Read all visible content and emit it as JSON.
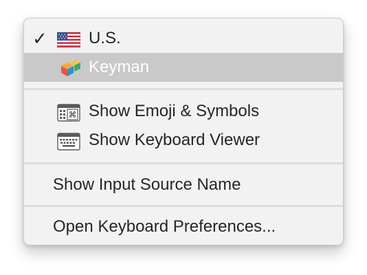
{
  "menu": {
    "items": [
      {
        "label": "U.S.",
        "checked": true,
        "icon": "us-flag-icon"
      },
      {
        "label": "Keyman",
        "selected": true,
        "icon": "keyman-icon"
      },
      {
        "label": "Show Emoji & Symbols",
        "icon": "emoji-symbols-icon"
      },
      {
        "label": "Show Keyboard Viewer",
        "icon": "keyboard-viewer-icon"
      },
      {
        "label": "Show Input Source Name"
      },
      {
        "label": "Open Keyboard Preferences..."
      }
    ],
    "checkmark": "✓"
  },
  "colors": {
    "menu_bg": "#f2f2f2",
    "highlight": "#c9c9c9",
    "text": "#262626",
    "highlight_text": "#ffffff",
    "separator": "#dcdcdc"
  }
}
